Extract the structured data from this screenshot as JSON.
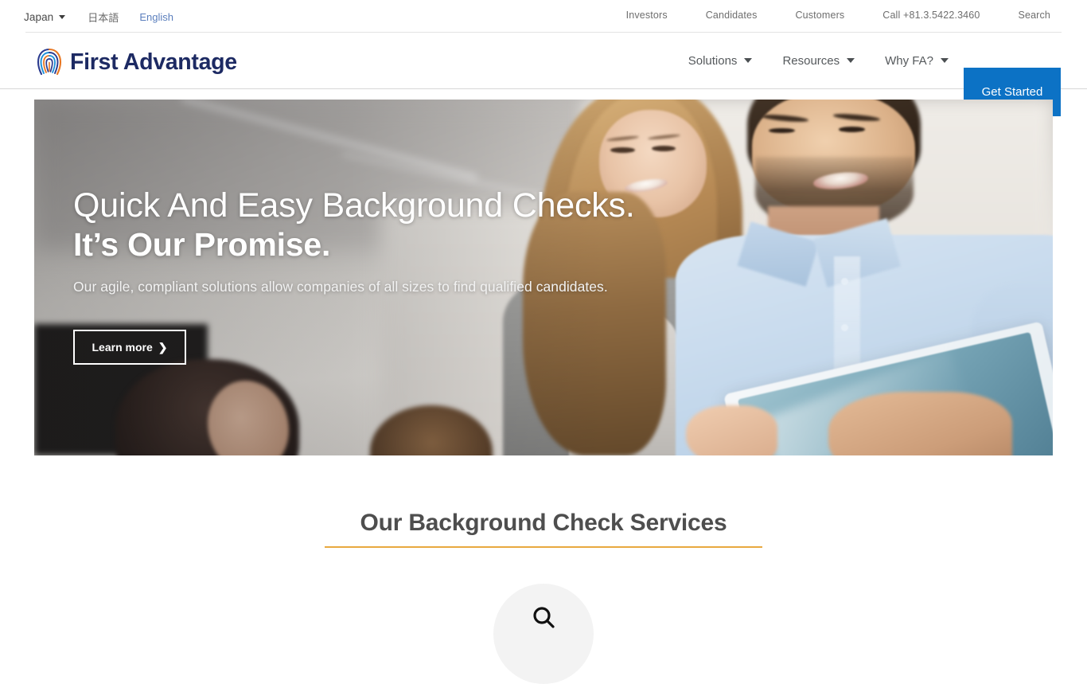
{
  "utility_bar": {
    "locale": {
      "country": "Japan",
      "caret": "chevron-down-icon"
    },
    "languages": [
      {
        "label": "日本語",
        "active": false
      },
      {
        "label": "English",
        "active": true
      }
    ],
    "links": [
      {
        "label": "Investors"
      },
      {
        "label": "Candidates"
      },
      {
        "label": "Customers"
      },
      {
        "label": "Call +81.3.5422.3460"
      },
      {
        "label": "Search"
      }
    ]
  },
  "header": {
    "logo": {
      "mark": "fingerprint-icon",
      "text": "First Advantage"
    },
    "nav": [
      {
        "label": "Solutions",
        "has_caret": true
      },
      {
        "label": "Resources",
        "has_caret": true
      },
      {
        "label": "Why FA?",
        "has_caret": true
      }
    ],
    "cta": {
      "label": "Get Started",
      "color": "#0c72c5"
    }
  },
  "hero": {
    "title_line1": "Quick And Easy Background Checks.",
    "title_line2": "It’s Our Promise.",
    "subtitle": "Our agile, compliant solutions allow companies of all sizes to find qualified candidates.",
    "cta": {
      "label": "Learn more",
      "chevron": "❯"
    }
  },
  "services": {
    "title": "Our Background Check Services",
    "rule_color": "#e8a93f",
    "bubble_icon": "magnifier-icon"
  }
}
